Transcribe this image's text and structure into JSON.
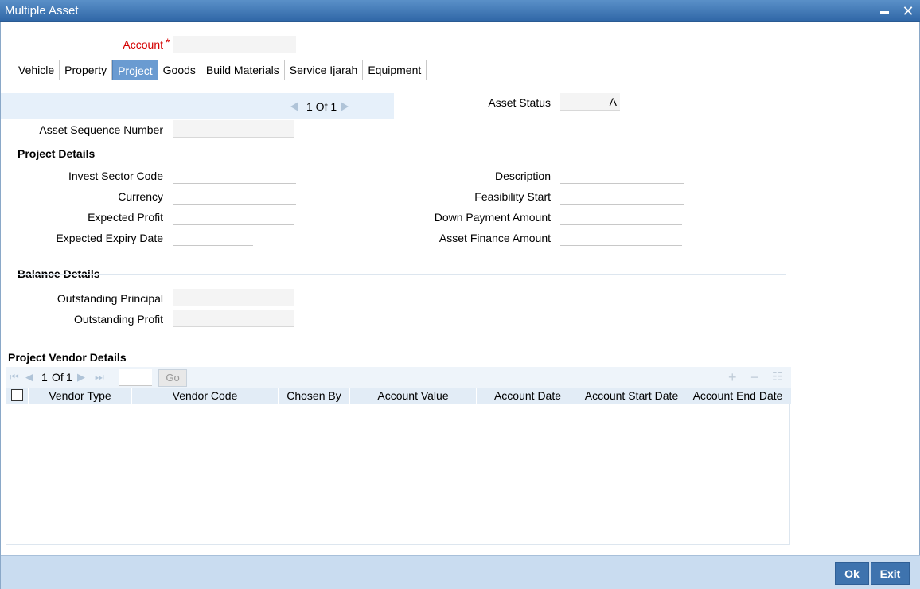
{
  "window": {
    "title": "Multiple Asset"
  },
  "account": {
    "label": "Account",
    "required_marker": "*",
    "value": ""
  },
  "tabs": [
    "Vehicle",
    "Property",
    "Project",
    "Goods",
    "Build Materials",
    "Service Ijarah",
    "Equipment"
  ],
  "active_tab": "Project",
  "record_nav": {
    "text": "1 Of 1"
  },
  "asset_status": {
    "label": "Asset Status",
    "value": "A"
  },
  "asset_sequence": {
    "label": "Asset Sequence Number",
    "value": ""
  },
  "project_details": {
    "title": "Project Details",
    "invest_sector_code": "Invest Sector Code",
    "currency": "Currency",
    "expected_profit": "Expected Profit",
    "expected_expiry_date": "Expected Expiry Date",
    "description": "Description",
    "feasibility_start": "Feasibility Start",
    "down_payment_amount": "Down Payment Amount",
    "asset_finance_amount": "Asset Finance Amount"
  },
  "balance_details": {
    "title": "Balance Details",
    "outstanding_principal": "Outstanding Principal",
    "outstanding_profit": "Outstanding Profit"
  },
  "vendor_details": {
    "title": "Project Vendor Details",
    "page_current": "1",
    "page_of": "Of",
    "page_total": "1",
    "go_label": "Go",
    "columns": [
      "Vendor Type",
      "Vendor Code",
      "Chosen By",
      "Account Value",
      "Account Date",
      "Account Start Date",
      "Account End Date"
    ]
  },
  "footer": {
    "ok_label": "Ok",
    "exit_label": "Exit"
  }
}
